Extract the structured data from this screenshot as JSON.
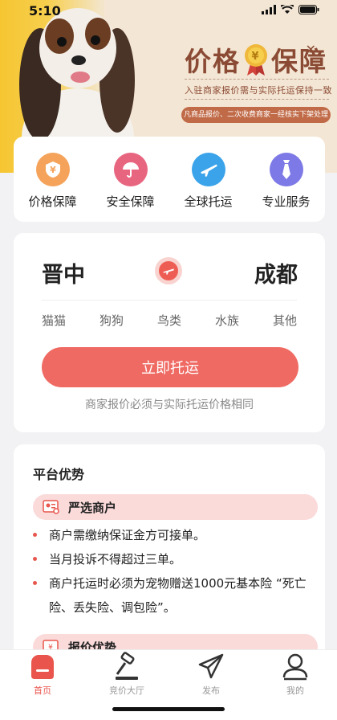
{
  "status": {
    "time": "5:10"
  },
  "banner": {
    "title_left": "价格",
    "title_right": "保障",
    "medal_symbol": "¥",
    "close_symbol": "✕",
    "subtitle": "入驻商家报价需与实际托运保持一致",
    "pill": "凡商品报价、二次收费商家一经核实下架处理"
  },
  "services": [
    {
      "label": "价格保障",
      "icon": "coin-shield-icon",
      "color": "#f5a35a"
    },
    {
      "label": "安全保障",
      "icon": "umbrella-icon",
      "color": "#e86580"
    },
    {
      "label": "全球托运",
      "icon": "airplane-icon",
      "color": "#3aa3ea"
    },
    {
      "label": "专业服务",
      "icon": "tie-icon",
      "color": "#7d79e6"
    }
  ],
  "route": {
    "from_city": "晋中",
    "to_city": "成都",
    "pets": [
      "猫猫",
      "狗狗",
      "鸟类",
      "水族",
      "其他"
    ],
    "ship_button": "立即托运",
    "note": "商家报价必须与实际托运价格相同"
  },
  "advantages": {
    "title": "平台优势",
    "sections": [
      {
        "label": "严选商户",
        "items": [
          "商户需缴纳保证金方可接单。",
          "当月投诉不得超过三单。",
          "商户托运时必须为宠物赠送1000元基本险 “死亡险、丢失险、调包险”。"
        ]
      },
      {
        "label": "报价优势"
      }
    ]
  },
  "tabs": [
    {
      "label": "首页",
      "icon": "home-icon",
      "active": true
    },
    {
      "label": "竞价大厅",
      "icon": "gavel-icon",
      "active": false
    },
    {
      "label": "发布",
      "icon": "paper-plane-icon",
      "active": false
    },
    {
      "label": "我的",
      "icon": "user-icon",
      "active": false
    }
  ],
  "colors": {
    "accent": "#ef6a63",
    "brand_brown": "#8a4a34",
    "active_tab": "#e9554d"
  }
}
